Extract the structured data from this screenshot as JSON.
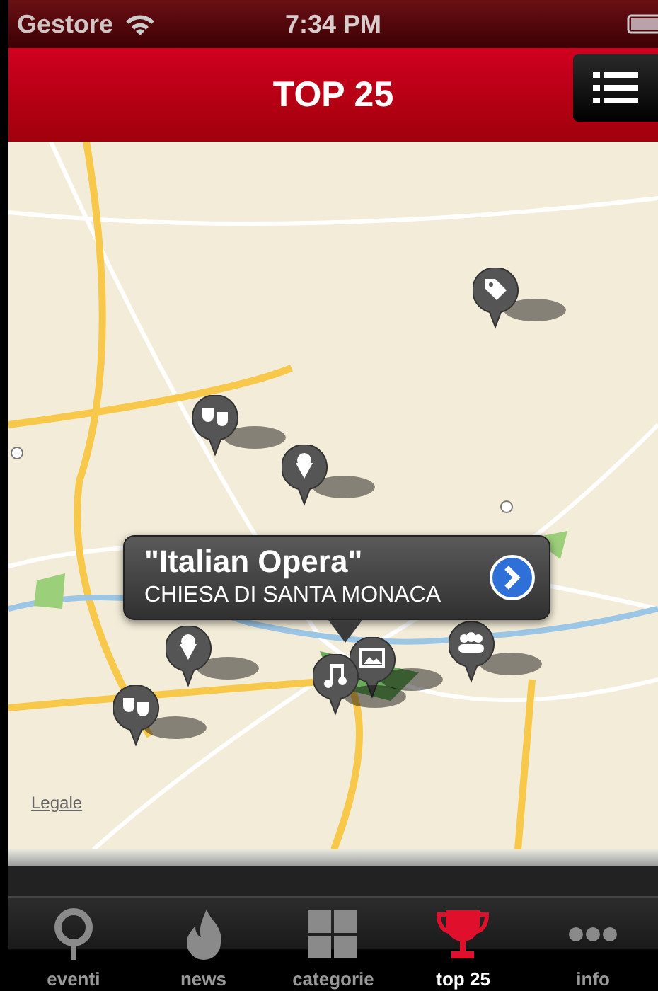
{
  "status_bar": {
    "carrier": "Gestore",
    "time": "7:34 PM"
  },
  "nav_bar": {
    "title": "TOP 25"
  },
  "map": {
    "kind": "picture",
    "pins": [
      {
        "kind": "tag"
      },
      {
        "kind": "masks"
      },
      {
        "kind": "ice-cream"
      },
      {
        "kind": "ice-cream"
      },
      {
        "kind": "masks"
      },
      {
        "kind": "people"
      },
      {
        "kind": "picture"
      },
      {
        "kind": "music"
      }
    ],
    "callout": {
      "title": "\"Italian Opera\"",
      "subtitle": "CHIESA DI SANTA MONACA"
    },
    "legal_link": "Legale"
  },
  "tab_bar": [
    {
      "label": "eventi",
      "kind": "pin",
      "selected": false
    },
    {
      "label": "news",
      "kind": "flame",
      "selected": false
    },
    {
      "label": "categorie",
      "kind": "grid",
      "selected": false
    },
    {
      "label": "top 25",
      "kind": "trophy",
      "selected": true
    },
    {
      "label": "info",
      "kind": "dots",
      "selected": false
    }
  ]
}
